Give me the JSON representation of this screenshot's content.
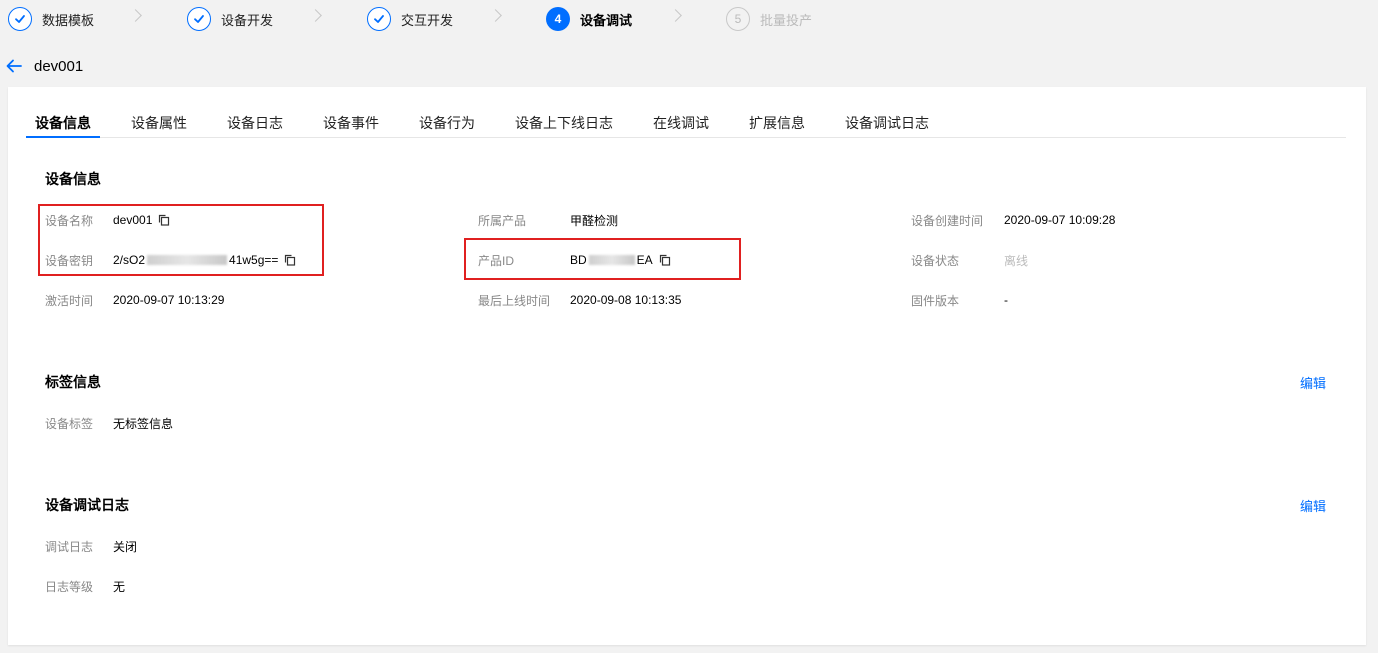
{
  "stepper": {
    "steps": [
      {
        "label": "数据模板",
        "status": "done",
        "number": ""
      },
      {
        "label": "设备开发",
        "status": "done",
        "number": ""
      },
      {
        "label": "交互开发",
        "status": "done",
        "number": ""
      },
      {
        "label": "设备调试",
        "status": "active",
        "number": "4"
      },
      {
        "label": "批量投产",
        "status": "pending",
        "number": "5"
      }
    ]
  },
  "header": {
    "title": "dev001"
  },
  "tabs": [
    {
      "label": "设备信息",
      "active": true
    },
    {
      "label": "设备属性"
    },
    {
      "label": "设备日志"
    },
    {
      "label": "设备事件"
    },
    {
      "label": "设备行为"
    },
    {
      "label": "设备上下线日志"
    },
    {
      "label": "在线调试"
    },
    {
      "label": "扩展信息"
    },
    {
      "label": "设备调试日志"
    }
  ],
  "device_info": {
    "title": "设备信息",
    "device_name": {
      "label": "设备名称",
      "value": "dev001"
    },
    "device_secret": {
      "label": "设备密钥",
      "value_prefix": "2/sO2",
      "value_suffix": "41w5g=="
    },
    "activate_time": {
      "label": "激活时间",
      "value": "2020-09-07 10:13:29"
    },
    "product": {
      "label": "所属产品",
      "value": "甲醛检测"
    },
    "product_id": {
      "label": "产品ID",
      "value_prefix": "BD",
      "value_suffix": "EA"
    },
    "last_online": {
      "label": "最后上线时间",
      "value": "2020-09-08 10:13:35"
    },
    "created_time": {
      "label": "设备创建时间",
      "value": "2020-09-07 10:09:28"
    },
    "status": {
      "label": "设备状态",
      "value": "离线"
    },
    "firmware": {
      "label": "固件版本",
      "value": "-"
    }
  },
  "tag_info": {
    "title": "标签信息",
    "edit_label": "编辑",
    "tags": {
      "label": "设备标签",
      "value": "无标签信息"
    }
  },
  "debug_log": {
    "title": "设备调试日志",
    "edit_label": "编辑",
    "log": {
      "label": "调试日志",
      "value": "关闭"
    },
    "level": {
      "label": "日志等级",
      "value": "无"
    }
  },
  "colors": {
    "accent": "#006eff",
    "highlight_box": "#e02020",
    "background": "#f2f2f2"
  }
}
